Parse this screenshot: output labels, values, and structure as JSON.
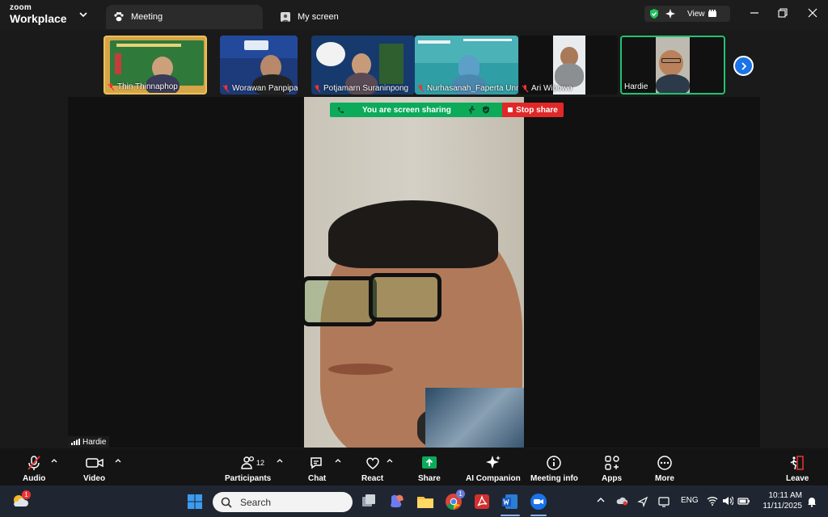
{
  "app": {
    "brand_top": "zoom",
    "brand_bottom": "Workplace"
  },
  "tabs": [
    {
      "label": "Meeting"
    },
    {
      "label": "My screen"
    }
  ],
  "view_button": {
    "label": "View"
  },
  "participants_strip": [
    {
      "name": "Thin Thinnaphop",
      "muted": true
    },
    {
      "name": "Worawan Panpipat",
      "muted": true
    },
    {
      "name": "Potjamarn Suraninpong",
      "muted": true
    },
    {
      "name": "Nurhasanah_Faperta Unm...",
      "muted": true
    },
    {
      "name": "Ari Wibowo",
      "muted": true
    },
    {
      "name": "Hardie",
      "muted": false
    }
  ],
  "share_banner": {
    "text": "You are screen sharing",
    "stop_label": "Stop share"
  },
  "active_speaker": {
    "name": "Hardie"
  },
  "toolbar": {
    "audio": "Audio",
    "video": "Video",
    "participants": "Participants",
    "participants_count": "12",
    "chat": "Chat",
    "react": "React",
    "share": "Share",
    "ai_companion": "AI Companion",
    "meeting_info": "Meeting info",
    "apps": "Apps",
    "more": "More",
    "leave": "Leave"
  },
  "taskbar": {
    "weather_badge": "1",
    "search_placeholder": "Search",
    "chrome_badge": "1",
    "language": "ENG",
    "time": "10:11 AM",
    "date": "11/11/2025"
  },
  "colors": {
    "share_green": "#0bab5a",
    "stop_red": "#e02828",
    "accent_blue": "#1a73e8",
    "active_border": "#21c271"
  }
}
